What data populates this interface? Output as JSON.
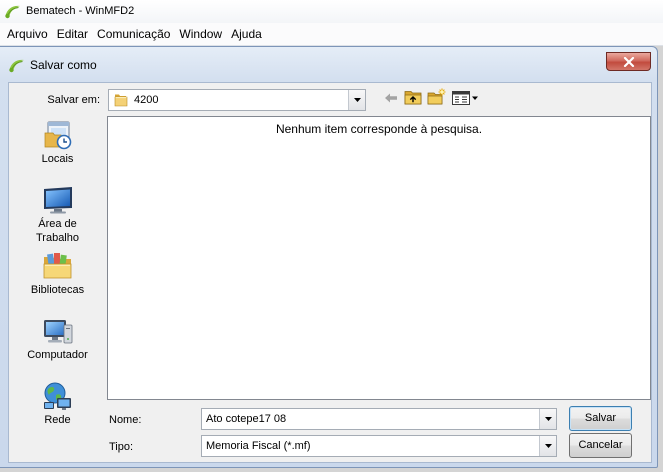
{
  "app": {
    "title": "Bematech - WinMFD2",
    "icon": "bematech-app-icon",
    "menu": [
      "Arquivo",
      "Editar",
      "Comunicação",
      "Window",
      "Ajuda"
    ]
  },
  "dialog": {
    "title": "Salvar como",
    "icon": "bematech-app-icon",
    "close_icon": "close-icon",
    "save_in": {
      "label": "Salvar em:",
      "value": "4200",
      "icon": "folder-icon"
    },
    "toolbar": {
      "back": {
        "icon": "back-arrow-icon",
        "enabled": false
      },
      "up": {
        "icon": "up-folder-icon"
      },
      "new_folder": {
        "icon": "new-folder-icon"
      },
      "views": {
        "icon": "views-menu-icon"
      }
    },
    "places": [
      {
        "label": "Locais",
        "icon": "recent-places-icon"
      },
      {
        "label": "Área de Trabalho",
        "icon": "desktop-icon"
      },
      {
        "label": "Bibliotecas",
        "icon": "libraries-icon"
      },
      {
        "label": "Computador",
        "icon": "computer-icon"
      },
      {
        "label": "Rede",
        "icon": "network-icon"
      }
    ],
    "file_list": {
      "empty_message": "Nenhum item corresponde à pesquisa.",
      "items": []
    },
    "file_name": {
      "label": "Nome:",
      "value": "Ato cotepe17 08"
    },
    "file_type": {
      "label": "Tipo:",
      "value": "Memoria Fiscal (*.mf)"
    },
    "buttons": {
      "save": "Salvar",
      "cancel": "Cancelar"
    }
  },
  "colors": {
    "close_button": "#c75050",
    "dialog_frame": "#cfdcee",
    "dialog_face": "#f0f0f0",
    "list_background": "#ffffff"
  }
}
